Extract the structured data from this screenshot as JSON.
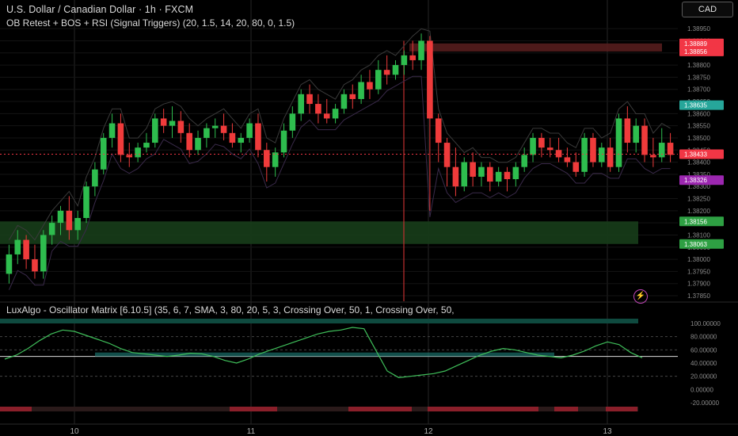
{
  "header": {
    "symbol_title": "U.S. Dollar / Canadian Dollar · 1h · FXCM",
    "indicator_title": "OB Retest + BOS + RSI (Signal Triggers) (20, 1.5, 14, 20, 80, 0, 1.5)",
    "currency_button": "CAD"
  },
  "oscillator": {
    "title": "LuxAlgo - Oscillator Matrix [6.10.5] (35, 6, 7, SMA, 3, 80, 20, 5, 3, Crossing Over, 50, 1, Crossing Over, 50,",
    "ticks": [
      "100.00000",
      "80.00000",
      "60.00000",
      "40.00000",
      "20.00000",
      "0.00000",
      "-20.00000"
    ]
  },
  "price_axis": {
    "ticks": [
      "1.38950",
      "1.38900",
      "1.38850",
      "1.38800",
      "1.38750",
      "1.38700",
      "1.38650",
      "1.38600",
      "1.38550",
      "1.38500",
      "1.38450",
      "1.38400",
      "1.38350",
      "1.38300",
      "1.38250",
      "1.38200",
      "1.38150",
      "1.38100",
      "1.38050",
      "1.38000",
      "1.37950",
      "1.37900",
      "1.37850"
    ],
    "badges": [
      {
        "text": "1.38889",
        "color": "#f23645"
      },
      {
        "text": "1.38856",
        "color": "#f23645"
      },
      {
        "text": "1.38635",
        "color": "#26a69a"
      },
      {
        "text": "1.38433",
        "color": "#f23645"
      },
      {
        "text": "1.38326",
        "color": "#9c27b0"
      },
      {
        "text": "1.38156",
        "color": "#2ea043"
      },
      {
        "text": "1.38063",
        "color": "#2ea043"
      }
    ]
  },
  "time_axis": {
    "ticks": [
      "10",
      "11",
      "12",
      "13"
    ]
  },
  "colors": {
    "up": "#2ebd4e",
    "down": "#ef3b3b",
    "supply": "#5a1f1f",
    "demand": "#173d1a",
    "grid": "#262626"
  },
  "chart_data": {
    "type": "candlestick",
    "title": "U.S. Dollar / Canadian Dollar · 1h · FXCM",
    "ylim": [
      1.3785,
      1.3897
    ],
    "last_price": 1.38433,
    "supply_zone": [
      1.38856,
      1.38889
    ],
    "demand_zone": [
      1.38063,
      1.38156
    ],
    "ohlc": [
      [
        1.3794,
        1.3806,
        1.379,
        1.3802
      ],
      [
        1.3802,
        1.3812,
        1.3798,
        1.3808
      ],
      [
        1.3808,
        1.381,
        1.3796,
        1.38
      ],
      [
        1.38,
        1.3806,
        1.3792,
        1.3795
      ],
      [
        1.3795,
        1.3812,
        1.3792,
        1.381
      ],
      [
        1.381,
        1.3818,
        1.3806,
        1.3815
      ],
      [
        1.3815,
        1.3822,
        1.381,
        1.382
      ],
      [
        1.382,
        1.3826,
        1.3808,
        1.3812
      ],
      [
        1.3812,
        1.382,
        1.3808,
        1.3817
      ],
      [
        1.3817,
        1.3832,
        1.3815,
        1.383
      ],
      [
        1.383,
        1.384,
        1.3826,
        1.3837
      ],
      [
        1.3837,
        1.3852,
        1.3835,
        1.385
      ],
      [
        1.385,
        1.386,
        1.3846,
        1.3856
      ],
      [
        1.3856,
        1.386,
        1.384,
        1.3843
      ],
      [
        1.3843,
        1.3848,
        1.3838,
        1.3842
      ],
      [
        1.3842,
        1.3848,
        1.384,
        1.3846
      ],
      [
        1.3846,
        1.3852,
        1.3844,
        1.3848
      ],
      [
        1.3848,
        1.386,
        1.3846,
        1.3858
      ],
      [
        1.3858,
        1.3862,
        1.3852,
        1.3855
      ],
      [
        1.3855,
        1.3863,
        1.385,
        1.3857
      ],
      [
        1.3857,
        1.3861,
        1.3848,
        1.3852
      ],
      [
        1.3852,
        1.3856,
        1.3842,
        1.3845
      ],
      [
        1.3845,
        1.3853,
        1.3843,
        1.385
      ],
      [
        1.385,
        1.3856,
        1.3846,
        1.3854
      ],
      [
        1.3854,
        1.3858,
        1.385,
        1.3855
      ],
      [
        1.3855,
        1.386,
        1.3849,
        1.3852
      ],
      [
        1.3852,
        1.3856,
        1.3846,
        1.3848
      ],
      [
        1.3848,
        1.3852,
        1.3844,
        1.385
      ],
      [
        1.385,
        1.3858,
        1.3848,
        1.3856
      ],
      [
        1.3856,
        1.386,
        1.3842,
        1.3845
      ],
      [
        1.3845,
        1.3848,
        1.3832,
        1.3838
      ],
      [
        1.3838,
        1.3846,
        1.3834,
        1.3844
      ],
      [
        1.3844,
        1.3856,
        1.3842,
        1.3853
      ],
      [
        1.3853,
        1.3863,
        1.385,
        1.386
      ],
      [
        1.386,
        1.387,
        1.3857,
        1.3868
      ],
      [
        1.3868,
        1.3872,
        1.386,
        1.3864
      ],
      [
        1.3864,
        1.3868,
        1.3856,
        1.386
      ],
      [
        1.386,
        1.3866,
        1.3856,
        1.3858
      ],
      [
        1.3858,
        1.3864,
        1.3856,
        1.3862
      ],
      [
        1.3862,
        1.387,
        1.386,
        1.3868
      ],
      [
        1.3868,
        1.3872,
        1.3862,
        1.3866
      ],
      [
        1.3866,
        1.3876,
        1.3864,
        1.3873
      ],
      [
        1.3873,
        1.3878,
        1.3866,
        1.387
      ],
      [
        1.387,
        1.3882,
        1.3868,
        1.3878
      ],
      [
        1.3878,
        1.3884,
        1.3872,
        1.3876
      ],
      [
        1.3876,
        1.3882,
        1.3874,
        1.388
      ],
      [
        1.388,
        1.3886,
        1.3876,
        1.3884
      ],
      [
        1.3884,
        1.389,
        1.3878,
        1.3882
      ],
      [
        1.3882,
        1.3893,
        1.3878,
        1.389
      ],
      [
        1.389,
        1.3892,
        1.382,
        1.3858
      ],
      [
        1.3858,
        1.386,
        1.384,
        1.3848
      ],
      [
        1.3848,
        1.385,
        1.383,
        1.3838
      ],
      [
        1.3838,
        1.3846,
        1.3826,
        1.383
      ],
      [
        1.383,
        1.3842,
        1.3828,
        1.384
      ],
      [
        1.384,
        1.3844,
        1.383,
        1.3834
      ],
      [
        1.3834,
        1.384,
        1.383,
        1.3838
      ],
      [
        1.3838,
        1.384,
        1.3828,
        1.3832
      ],
      [
        1.3832,
        1.3838,
        1.383,
        1.3836
      ],
      [
        1.3836,
        1.3838,
        1.3828,
        1.3833
      ],
      [
        1.3833,
        1.384,
        1.383,
        1.3838
      ],
      [
        1.3838,
        1.3846,
        1.3836,
        1.3843
      ],
      [
        1.3843,
        1.3852,
        1.384,
        1.385
      ],
      [
        1.385,
        1.3852,
        1.3842,
        1.3846
      ],
      [
        1.3846,
        1.385,
        1.3842,
        1.3845
      ],
      [
        1.3845,
        1.385,
        1.384,
        1.3842
      ],
      [
        1.3842,
        1.3846,
        1.3838,
        1.384
      ],
      [
        1.384,
        1.3844,
        1.3834,
        1.3836
      ],
      [
        1.3836,
        1.3852,
        1.3834,
        1.385
      ],
      [
        1.385,
        1.3852,
        1.3838,
        1.384
      ],
      [
        1.384,
        1.3848,
        1.3838,
        1.3846
      ],
      [
        1.3846,
        1.385,
        1.3836,
        1.3838
      ],
      [
        1.3838,
        1.386,
        1.3836,
        1.3858
      ],
      [
        1.3858,
        1.3863,
        1.3844,
        1.3848
      ],
      [
        1.3848,
        1.3858,
        1.3844,
        1.3855
      ],
      [
        1.3855,
        1.3858,
        1.384,
        1.3843
      ],
      [
        1.3843,
        1.385,
        1.3838,
        1.3842
      ],
      [
        1.3842,
        1.3854,
        1.384,
        1.3848
      ],
      [
        1.3848,
        1.3852,
        1.384,
        1.3843
      ]
    ]
  }
}
